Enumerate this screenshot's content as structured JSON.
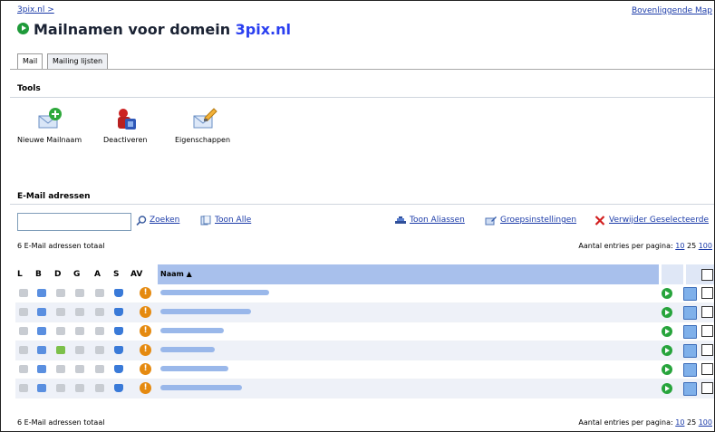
{
  "breadcrumb": "3pix.nl >",
  "page": {
    "title_prefix": "Mailnamen voor domein",
    "domain": "3pix.nl",
    "top_link": "Bovenliggende Map"
  },
  "tabs": [
    {
      "label": "Mail",
      "active": true
    },
    {
      "label": "Mailing lijsten",
      "active": false
    }
  ],
  "tools": {
    "section_title": "Tools",
    "items": [
      {
        "label": "Nieuwe Mailnaam",
        "icon": "new-mail-icon"
      },
      {
        "label": "Deactiveren",
        "icon": "deactivate-icon"
      },
      {
        "label": "Eigenschappen",
        "icon": "properties-icon"
      }
    ]
  },
  "email_section": {
    "section_title": "E-Mail adressen",
    "search_value": "",
    "search_label": "Zoeken",
    "show_all_label": "Toon Alle",
    "show_aliases_label": "Toon Aliassen",
    "group_settings_label": "Groepsinstellingen",
    "delete_selected_label": "Verwijder Geselecteerde"
  },
  "count_top": "6 E-Mail adressen totaal",
  "count_bottom": "6 E-Mail adressen totaal",
  "per_page": {
    "label": "Aantal entries per pagina:",
    "options": [
      "10",
      "25",
      "100"
    ],
    "current": "25"
  },
  "table": {
    "columns": [
      "L",
      "B",
      "D",
      "G",
      "A",
      "S",
      "AV"
    ],
    "name_header": "Naam ▲",
    "rows": [
      {
        "email": "",
        "d_active": false
      },
      {
        "email": "",
        "d_active": false
      },
      {
        "email": "",
        "d_active": false
      },
      {
        "email": "",
        "d_active": true
      },
      {
        "email": "",
        "d_active": false
      },
      {
        "email": "",
        "d_active": false
      }
    ]
  },
  "colors": {
    "header_blue": "#a8c0ec",
    "link": "#1a3aa8",
    "domain": "#2a3ff0",
    "title_icon": "#1f9a3a",
    "warn": "#e58a10"
  }
}
